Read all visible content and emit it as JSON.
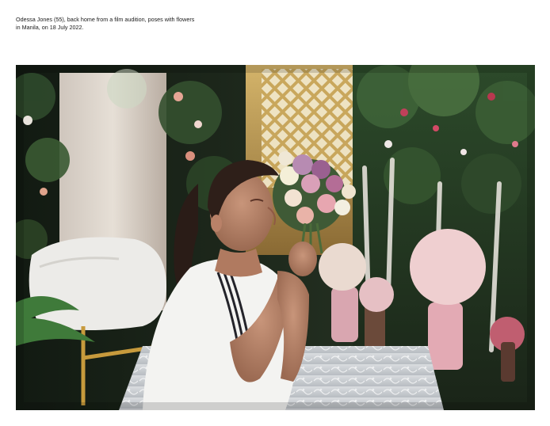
{
  "caption": {
    "line1": "Odessa Jones (55), back home from a film audition, poses with flowers",
    "line2": "in Manila, on 18 July 2022."
  },
  "photo": {
    "alt": "Odessa Jones (55), back home from a film audition, poses with flowers in Manila, on 18 July 2022."
  }
}
